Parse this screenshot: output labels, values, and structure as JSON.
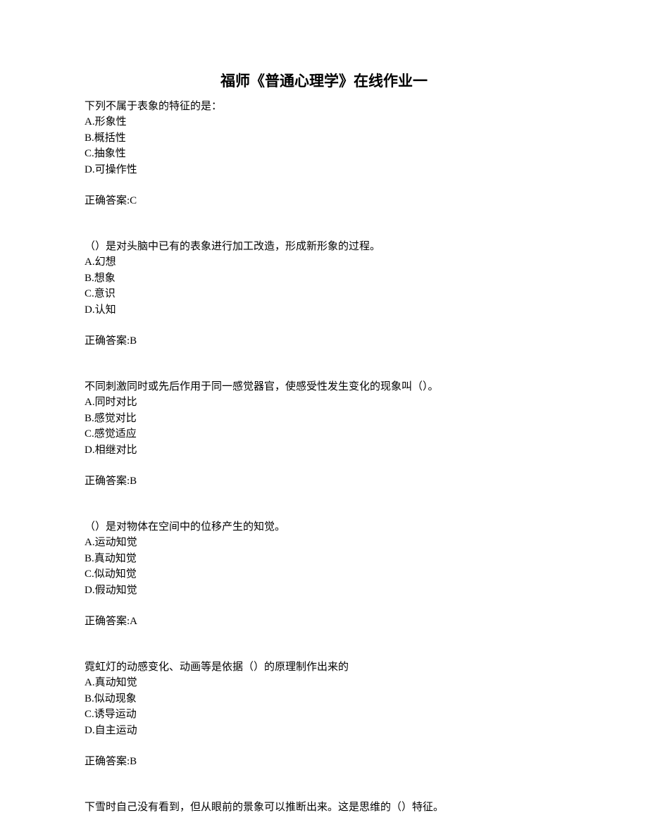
{
  "title": "福师《普通心理学》在线作业一",
  "questions": [
    {
      "text": "下列不属于表象的特征的是：",
      "options": [
        "A.形象性",
        "B.概括性",
        "C.抽象性",
        "D.可操作性"
      ],
      "answer": "正确答案:C"
    },
    {
      "text": "（）是对头脑中已有的表象进行加工改造，形成新形象的过程。",
      "options": [
        "A.幻想",
        "B.想象",
        "C.意识",
        "D.认知"
      ],
      "answer": "正确答案:B"
    },
    {
      "text": "不同刺激同时或先后作用于同一感觉器官，使感受性发生变化的现象叫（）。",
      "options": [
        "A.同时对比",
        "B.感觉对比",
        "C.感觉适应",
        "D.相继对比"
      ],
      "answer": "正确答案:B"
    },
    {
      "text": "（）是对物体在空间中的位移产生的知觉。",
      "options": [
        "A.运动知觉",
        "B.真动知觉",
        "C.似动知觉",
        "D.假动知觉"
      ],
      "answer": "正确答案:A"
    },
    {
      "text": "霓虹灯的动感变化、动画等是依据（）的原理制作出来的",
      "options": [
        "A.真动知觉",
        "B.似动现象",
        "C.诱导运动",
        "D.自主运动"
      ],
      "answer": "正确答案:B"
    },
    {
      "text": "下雪时自己没有看到，但从眼前的景象可以推断出来。这是思维的（）特征。",
      "options": [],
      "answer": ""
    }
  ]
}
